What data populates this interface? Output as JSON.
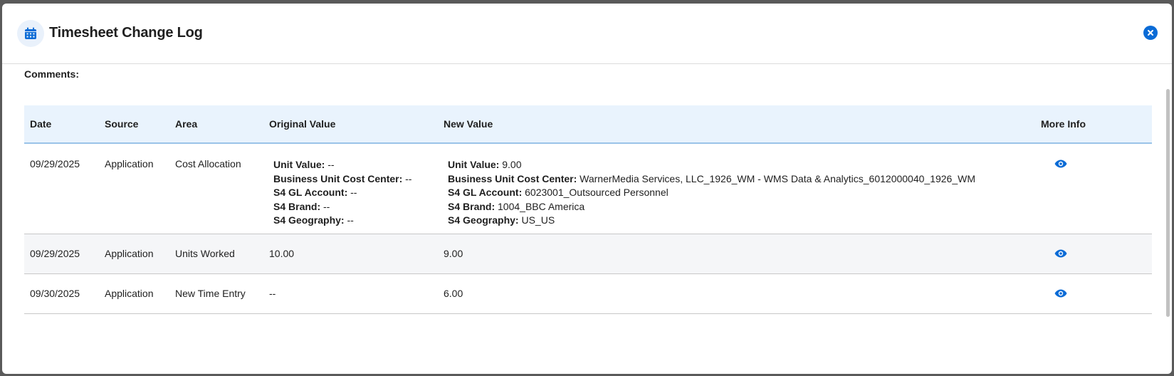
{
  "modal": {
    "title": "Timesheet Change Log",
    "header_icon": "calendar-icon",
    "close_icon": "close-icon",
    "accent_color": "#0a6bd6"
  },
  "comments": {
    "label": "Comments:"
  },
  "table": {
    "headers": {
      "date": "Date",
      "source": "Source",
      "area": "Area",
      "original": "Original Value",
      "new": "New Value",
      "more_info": "More Info"
    },
    "rows": [
      {
        "date": "09/29/2025",
        "source": "Application",
        "area": "Cost Allocation",
        "original": [
          {
            "label": "Unit Value:",
            "value": " --"
          },
          {
            "label": "Business Unit Cost Center:",
            "value": " --"
          },
          {
            "label": "S4 GL Account:",
            "value": " --"
          },
          {
            "label": "S4 Brand:",
            "value": " --"
          },
          {
            "label": "S4 Geography:",
            "value": " --"
          }
        ],
        "new": [
          {
            "label": "Unit Value:",
            "value": " 9.00"
          },
          {
            "label": "Business Unit Cost Center:",
            "value": " WarnerMedia Services, LLC_1926_WM - WMS Data & Analytics_6012000040_1926_WM"
          },
          {
            "label": "S4 GL Account:",
            "value": " 6023001_Outsourced Personnel"
          },
          {
            "label": "S4 Brand:",
            "value": " 1004_BBC America"
          },
          {
            "label": "S4 Geography:",
            "value": " US_US"
          }
        ],
        "more_info_icon": "eye-icon"
      },
      {
        "date": "09/29/2025",
        "source": "Application",
        "area": "Units Worked",
        "original_text": "10.00",
        "new_text": "9.00",
        "more_info_icon": "eye-icon"
      },
      {
        "date": "09/30/2025",
        "source": "Application",
        "area": "New Time Entry",
        "original_text": "--",
        "new_text": "6.00",
        "more_info_icon": "eye-icon"
      }
    ]
  }
}
